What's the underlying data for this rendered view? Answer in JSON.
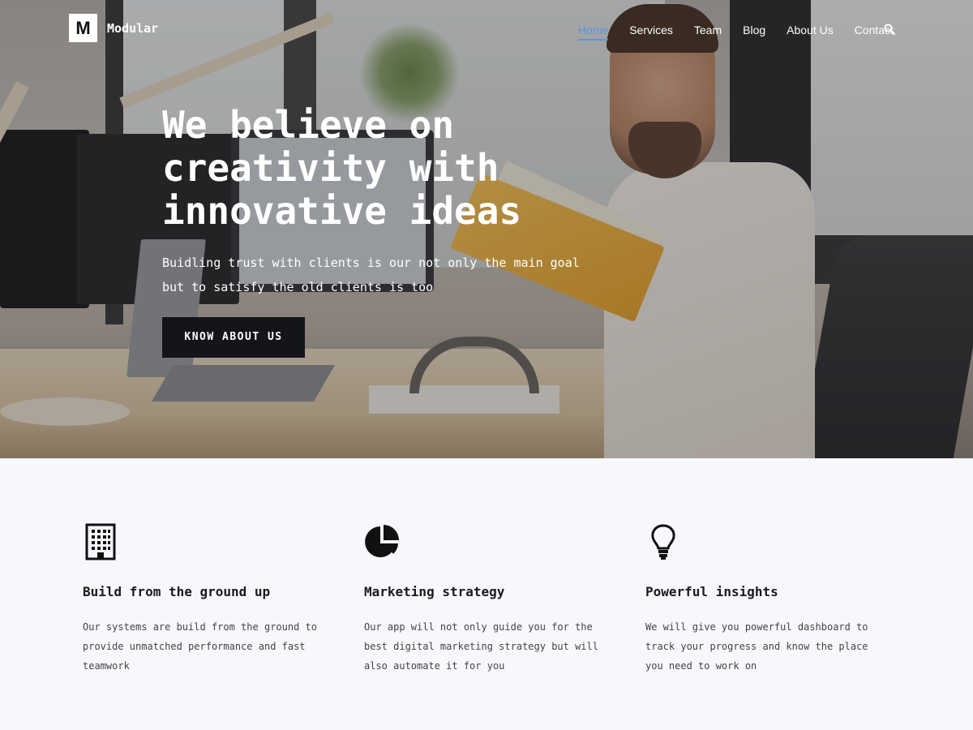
{
  "brand": {
    "logo_letter": "M",
    "name": "Modular"
  },
  "nav": {
    "items": [
      {
        "label": "Home",
        "active": true
      },
      {
        "label": "Services"
      },
      {
        "label": "Team"
      },
      {
        "label": "Blog"
      },
      {
        "label": "About Us"
      },
      {
        "label": "Contact"
      }
    ],
    "search_icon": "search-icon",
    "active_color": "#5b93e6"
  },
  "hero": {
    "title": "We believe on creativity with innovative ideas",
    "subtitle": "Buidling trust with clients is our not only the main goal but to satisfy the old clients is too",
    "cta_label": "KNOW ABOUT US",
    "cta_color": "#13151b"
  },
  "features": [
    {
      "icon": "building-icon",
      "title": "Build from the ground up",
      "description": "Our systems are build from the ground to provide unmatched performance and fast teamwork"
    },
    {
      "icon": "pie-chart-icon",
      "title": "Marketing strategy",
      "description": "Our app will not only guide you for the best digital marketing strategy but will also automate it for you"
    },
    {
      "icon": "lightbulb-icon",
      "title": "Powerful insights",
      "description": "We will give you powerful dashboard to track your progress and know the place you need to work on"
    }
  ]
}
